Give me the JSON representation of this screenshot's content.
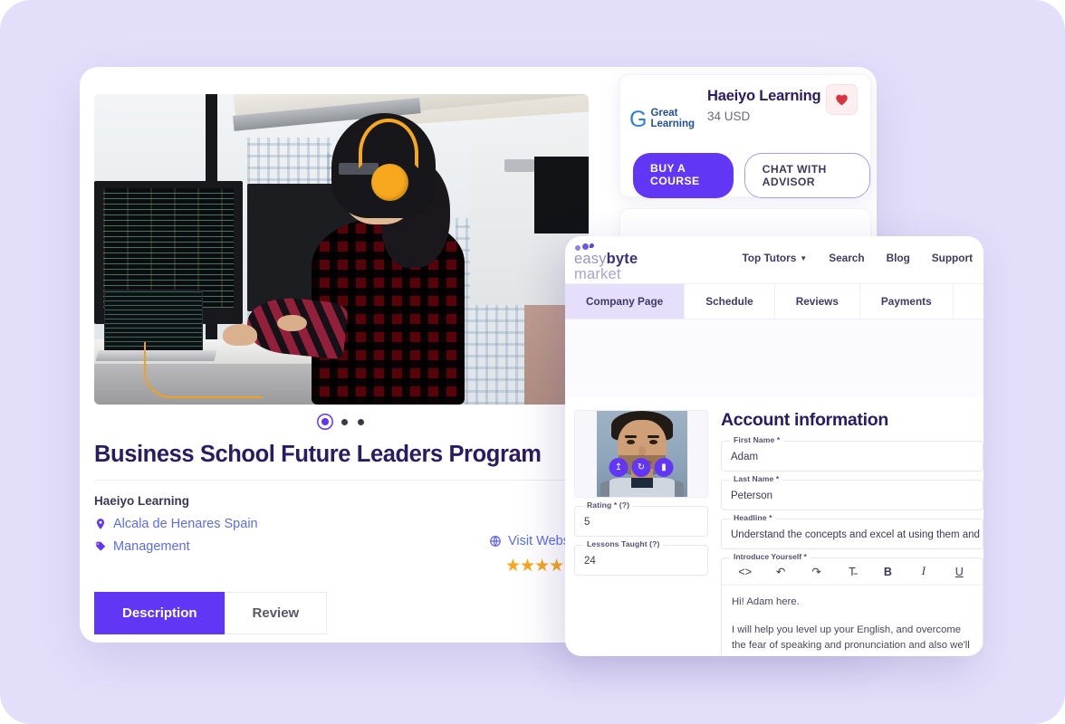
{
  "theme": {
    "background": "#e3dffa",
    "primary": "#6236f5",
    "title_color": "#2b1b63",
    "link_color": "#5b6cf0",
    "star_color": "#f7a51b",
    "heart_color": "#d8333f"
  },
  "course": {
    "title": "Business School Future Leaders Program",
    "provider": "Haeiyo Learning",
    "location": "Alcala de Henares Spain",
    "category": "Management",
    "visit_website": "Visit Website",
    "stars": "★★★★★",
    "rating_stars": 5,
    "carousel": {
      "total_dots": 3,
      "active_index": 0
    },
    "tabs": [
      {
        "label": "Description",
        "active": true
      },
      {
        "label": "Review",
        "active": false
      }
    ],
    "icons": {
      "location": "location-pin-icon",
      "category": "tag-icon",
      "website": "globe-icon"
    }
  },
  "offer_card": {
    "brand_logo_mark": "G",
    "brand_logo_line1": "Great",
    "brand_logo_line2": "Learning",
    "title": "Haeiyo Learning",
    "price": "34 USD",
    "favorite_icon": "heart-icon",
    "buy_label": "BUY A COURSE",
    "chat_label": "CHAT WITH ADVISOR"
  },
  "overlay": {
    "logo": {
      "line1_light": "easy",
      "line1_bold": "byte",
      "line2": "market"
    },
    "nav_links": [
      {
        "label": "Top Tutors",
        "has_caret": true
      },
      {
        "label": "Search",
        "has_caret": false
      },
      {
        "label": "Blog",
        "has_caret": false
      },
      {
        "label": "Support",
        "has_caret": false
      }
    ],
    "tabs": [
      {
        "label": "Company Page",
        "active": true
      },
      {
        "label": "Schedule",
        "active": false
      },
      {
        "label": "Reviews",
        "active": false
      },
      {
        "label": "Payments",
        "active": false
      }
    ],
    "avatar": {
      "actions": [
        {
          "name": "upload-avatar-button",
          "glyph": "↥"
        },
        {
          "name": "rotate-avatar-button",
          "glyph": "↻"
        },
        {
          "name": "delete-avatar-button",
          "glyph": "▮"
        }
      ]
    },
    "left_fields": [
      {
        "label": "Rating * (?)",
        "value": "5"
      },
      {
        "label": "Lessons Taught (?)",
        "value": "24"
      }
    ],
    "section_title": "Account information",
    "right_fields": [
      {
        "label": "First Name *",
        "value": "Adam"
      },
      {
        "label": "Last Name *",
        "value": "Peterson"
      },
      {
        "label": "Headline *",
        "value": "Understand the concepts and excel at using them and that is how you will become"
      }
    ],
    "editor": {
      "label": "Introduce Yourself *",
      "toolbar": [
        {
          "name": "code-view-button",
          "glyph": "<>"
        },
        {
          "name": "undo-button",
          "glyph": "↶"
        },
        {
          "name": "redo-button",
          "glyph": "↷"
        },
        {
          "name": "clear-format-button",
          "glyph": "T̵"
        },
        {
          "name": "bold-button",
          "glyph": "B"
        },
        {
          "name": "italic-button",
          "glyph": "I"
        },
        {
          "name": "underline-button",
          "glyph": "U"
        }
      ],
      "paragraph1": "Hi! Adam here.",
      "paragraph2": "I will help you level up your English, and overcome the fear of speaking and pronunciation and also we'll expand your vocabulary."
    }
  }
}
